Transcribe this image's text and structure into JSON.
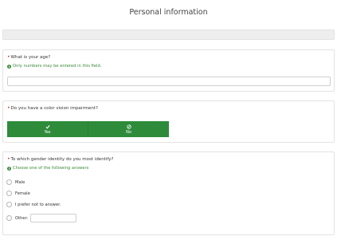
{
  "page": {
    "title": "Personal information"
  },
  "questions": {
    "age": {
      "text": "What is your age?",
      "tip": "Only numbers may be entered in this field.",
      "value": ""
    },
    "color_vision": {
      "text": "Do you have a color vision impairment?",
      "yes_label": "Yes",
      "no_label": "No"
    },
    "gender": {
      "text": "To which gender identity do you most identify?",
      "tip": "Choose one of the following answers",
      "options": [
        "Male",
        "Female",
        "I prefer not to answer.",
        "Other:"
      ],
      "other_value": ""
    }
  },
  "colors": {
    "accent": "#2e8b3a",
    "required": "#c0392b",
    "tip": "#3d8b3d"
  }
}
